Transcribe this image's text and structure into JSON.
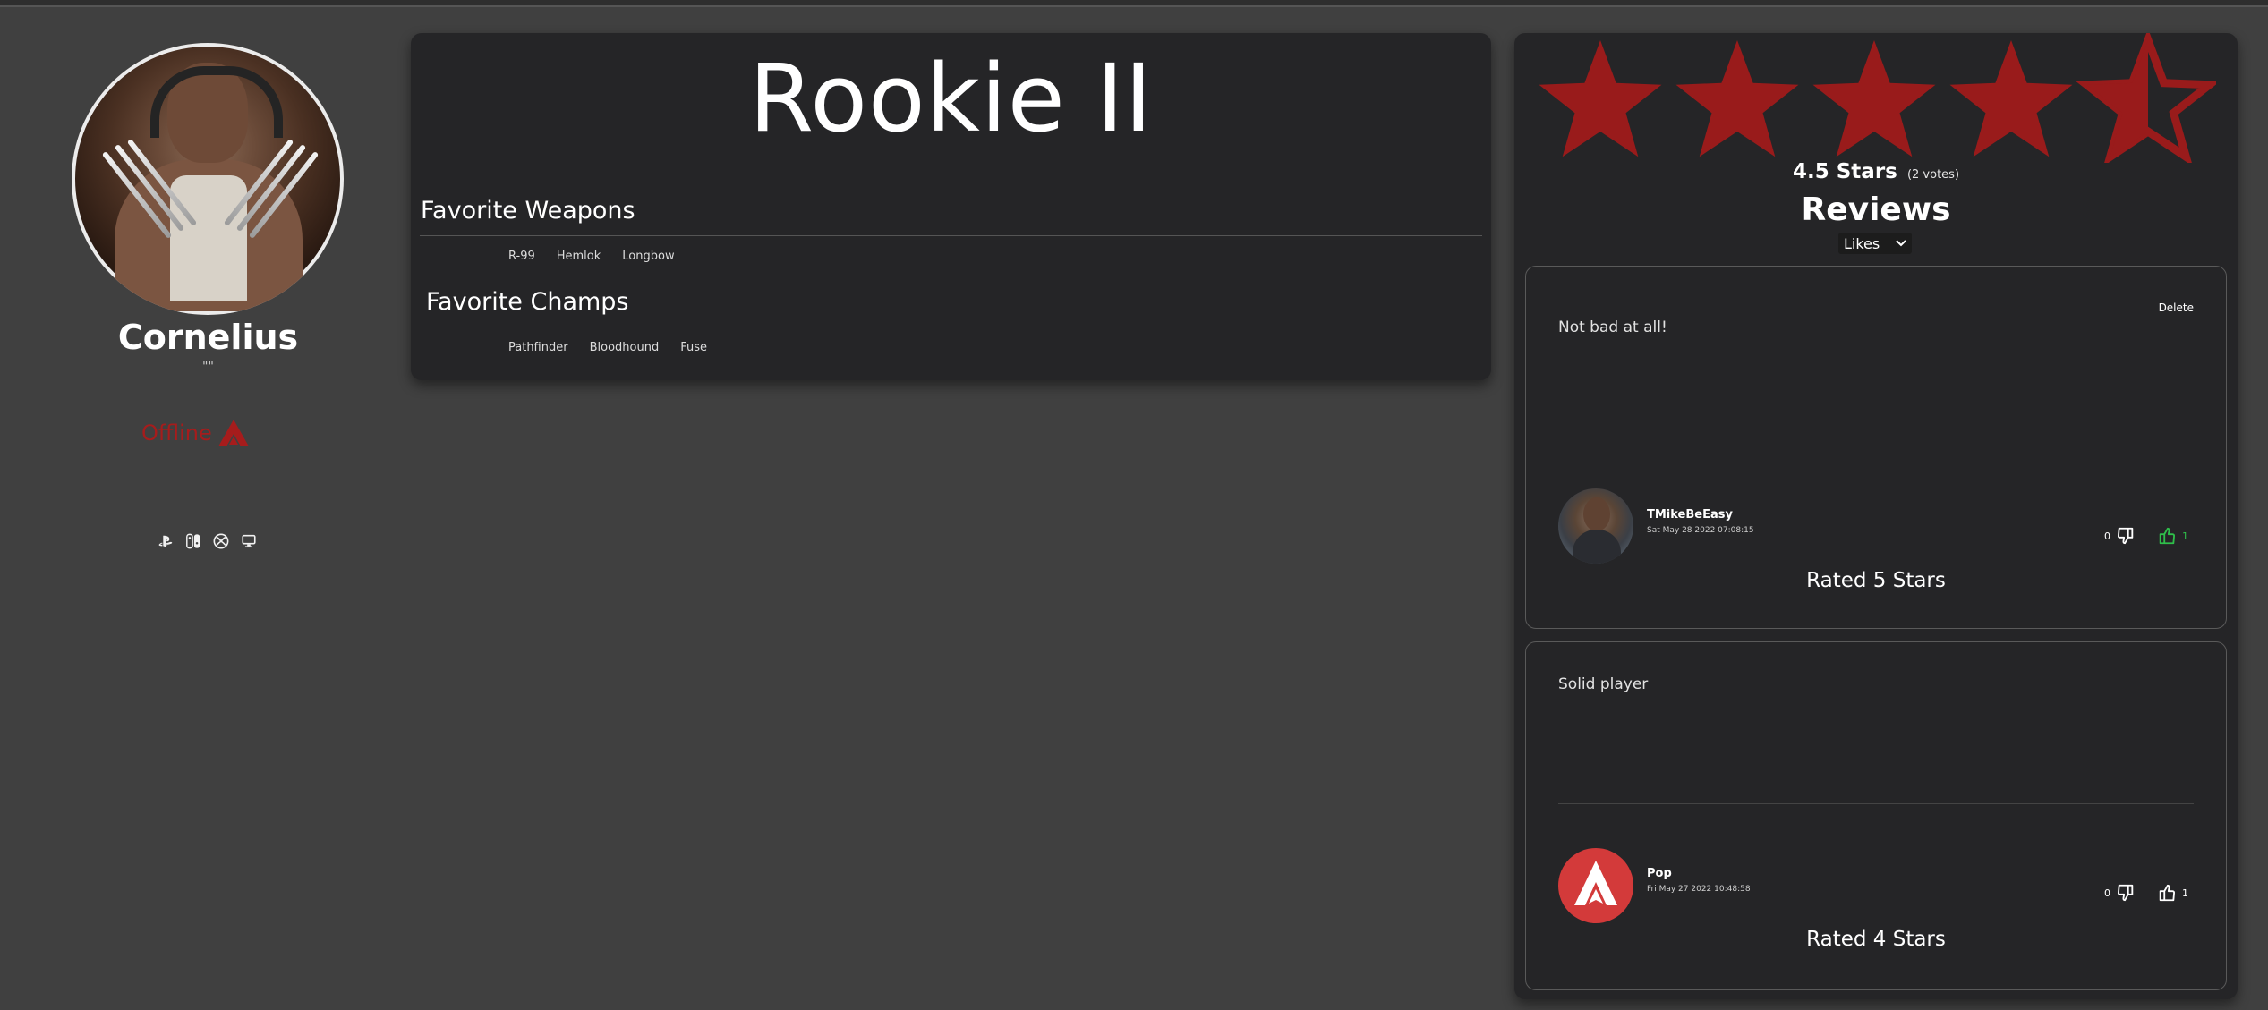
{
  "profile": {
    "username": "Cornelius",
    "quote": "\"\"",
    "status": "Offline",
    "platforms": [
      "playstation-icon",
      "switch-icon",
      "xbox-icon",
      "pc-icon"
    ]
  },
  "rank": {
    "title": "Rookie II"
  },
  "favorites": {
    "weapons_title": "Favorite Weapons",
    "weapons": [
      "R-99",
      "Hemlok",
      "Longbow"
    ],
    "champs_title": "Favorite Champs",
    "champs": [
      "Pathfinder",
      "Bloodhound",
      "Fuse"
    ]
  },
  "rating": {
    "value_text": "4.5 Stars",
    "value": 4.5,
    "max": 5,
    "votes_text": "(2 votes)",
    "star_color": "#991b1b"
  },
  "reviews": {
    "title": "Reviews",
    "sort_selected": "Likes",
    "items": [
      {
        "text": "Not bad at all!",
        "delete_label": "Delete",
        "author": "TMikeBeEasy",
        "date": "Sat May 28 2022 07:08:15",
        "dislikes": "0",
        "likes": "1",
        "liked": true,
        "rated": "Rated 5 Stars"
      },
      {
        "text": "Solid player",
        "author": "Pop",
        "date": "Fri May 27 2022 10:48:58",
        "dislikes": "0",
        "likes": "1",
        "liked": false,
        "rated": "Rated 4 Stars"
      }
    ]
  },
  "colors": {
    "accent_red": "#a61c1c",
    "like_green": "#2fbf4a",
    "card_bg": "#252527",
    "page_bg": "#404040"
  }
}
